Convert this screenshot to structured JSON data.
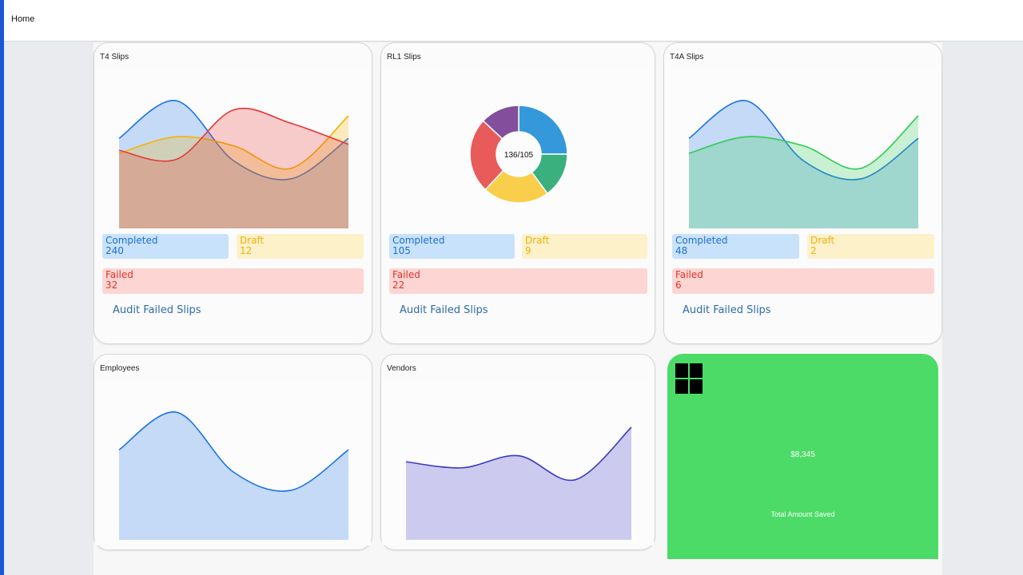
{
  "topbar": {
    "home_label": "Home"
  },
  "cards": {
    "t4": {
      "title": "T4 Slips",
      "completed_label": "Completed",
      "completed_value": "240",
      "draft_label": "Draft",
      "draft_value": "12",
      "failed_label": "Failed",
      "failed_value": "32",
      "audit_link": "Audit Failed Slips"
    },
    "rl1": {
      "title": "RL1 Slips",
      "donut_center": "136/105",
      "completed_label": "Completed",
      "completed_value": "105",
      "draft_label": "Draft",
      "draft_value": "9",
      "failed_label": "Failed",
      "failed_value": "22",
      "audit_link": "Audit Failed Slips"
    },
    "t4a": {
      "title": "T4A Slips",
      "completed_label": "Completed",
      "completed_value": "48",
      "draft_label": "Draft",
      "draft_value": "2",
      "failed_label": "Failed",
      "failed_value": "6",
      "audit_link": "Audit Failed Slips"
    },
    "employees": {
      "title": "Employees"
    },
    "vendors": {
      "title": "Vendors"
    },
    "savings": {
      "amount": "$8,345",
      "label": "Total Amount Saved",
      "icon": "windows-icon"
    }
  },
  "colors": {
    "accent_blue": "#1a56d6",
    "completed": "#1d6fcf",
    "draft": "#efb20c",
    "failed": "#e0332b",
    "savings_green": "#4cdb67"
  },
  "chart_data": [
    {
      "type": "area",
      "chart": "T4 Slips",
      "x": [
        0,
        1,
        2,
        3,
        4
      ],
      "series": [
        {
          "values": [
            60,
            85,
            45,
            33,
            60
          ],
          "color": "#1a73e8"
        },
        {
          "values": [
            50,
            61,
            55,
            40,
            75
          ],
          "color": "#f4b400"
        },
        {
          "values": [
            52,
            46,
            79,
            70,
            56
          ],
          "color": "#e53935"
        }
      ],
      "ylim": [
        0,
        100
      ]
    },
    {
      "type": "pie",
      "chart": "RL1 Slips",
      "segments": [
        {
          "value": 25,
          "color": "#3498db"
        },
        {
          "value": 15,
          "color": "#3bb07f"
        },
        {
          "value": 22,
          "color": "#f9ce4b"
        },
        {
          "value": 25,
          "color": "#e95b5b"
        },
        {
          "value": 13,
          "color": "#834e9c"
        }
      ]
    },
    {
      "type": "area",
      "chart": "T4A Slips",
      "x": [
        0,
        1,
        2,
        3,
        4
      ],
      "series": [
        {
          "values": [
            60,
            85,
            45,
            33,
            60
          ],
          "color": "#1a73e8"
        },
        {
          "values": [
            50,
            61,
            55,
            40,
            75
          ],
          "color": "#2ecc55"
        }
      ],
      "ylim": [
        0,
        100
      ]
    },
    {
      "type": "area",
      "chart": "Employees",
      "x": [
        0,
        1,
        2,
        3,
        4
      ],
      "series": [
        {
          "values": [
            60,
            85,
            45,
            33,
            60
          ],
          "color": "#1a73e8"
        }
      ],
      "ylim": [
        0,
        100
      ]
    },
    {
      "type": "area",
      "chart": "Vendors",
      "x": [
        0,
        1,
        2,
        3,
        4
      ],
      "series": [
        {
          "values": [
            52,
            48,
            56,
            40,
            75
          ],
          "color": "#3a39c6"
        }
      ],
      "ylim": [
        0,
        100
      ]
    }
  ]
}
